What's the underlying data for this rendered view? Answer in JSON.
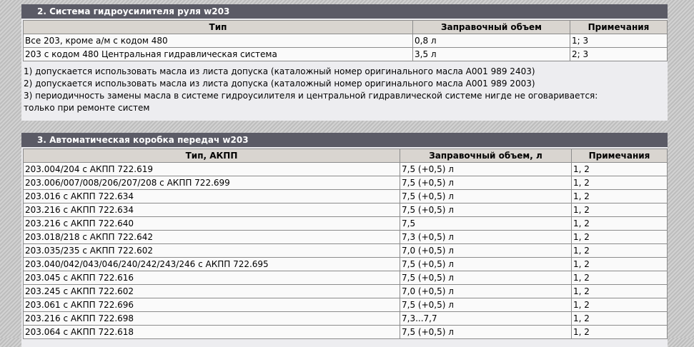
{
  "section2": {
    "title": "2. Система гидроусилителя руля w203",
    "headers": [
      "Тип",
      "Заправочный объем",
      "Примечания"
    ],
    "rows": [
      [
        "Все 203, кроме а/м с кодом 480",
        "0,8 л",
        "1; 3"
      ],
      [
        "203 с кодом 480 Центральная гидравлическая система",
        "3,5 л",
        "2; 3"
      ]
    ],
    "notes": [
      "1) допускается использовать масла из листа допуска (каталожный номер оригинального масла A001 989 2403)",
      "2) допускается использовать масла из листа допуска (каталожный номер оригинального масла A001 989 2003)",
      "3) периодичность замены масла в системе гидроусилителя и центральной гидравлической системе нигде не оговаривается:",
      "только при ремонте систем"
    ]
  },
  "section3": {
    "title": "3. Автоматическая коробка передач w203",
    "headers": [
      "Тип, АКПП",
      "Заправочный объем, л",
      "Примечания"
    ],
    "rows": [
      [
        "203.004/204 с АКПП 722.619",
        "7,5 (+0,5) л",
        "1, 2"
      ],
      [
        "203.006/007/008/206/207/208 с АКПП 722.699",
        "7,5 (+0,5) л",
        "1, 2"
      ],
      [
        "203.016 с АКПП 722.634",
        "7,5 (+0,5) л",
        "1, 2"
      ],
      [
        "203.216 с АКПП 722.634",
        "7,5 (+0,5) л",
        "1, 2"
      ],
      [
        "203.216 с АКПП 722.640",
        "7,5",
        "1, 2"
      ],
      [
        "203.018/218 с АКПП 722.642",
        "7,3 (+0,5) л",
        "1, 2"
      ],
      [
        "203.035/235 с АКПП 722.602",
        "7,0 (+0,5) л",
        "1, 2"
      ],
      [
        "203.040/042/043/046/240/242/243/246 с АКПП 722.695",
        "7,5 (+0,5) л",
        "1, 2"
      ],
      [
        "203.045 с АКПП 722.616",
        "7,5 (+0,5) л",
        "1, 2"
      ],
      [
        "203.245 с АКПП 722.602",
        "7,0 (+0,5) л",
        "1, 2"
      ],
      [
        "203.061 с АКПП 722.696",
        "7,5 (+0,5) л",
        "1, 2"
      ],
      [
        "203.216 с АКПП 722.698",
        "7,3...7,7",
        "1, 2"
      ],
      [
        "203.064 с АКПП 722.618",
        "7,5 (+0,5) л",
        "1, 2"
      ]
    ]
  }
}
